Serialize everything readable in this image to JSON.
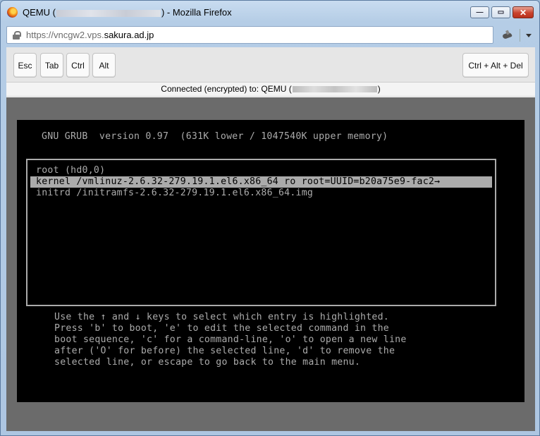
{
  "window": {
    "title_prefix": "QEMU (",
    "title_suffix": ") - Mozilla Firefox",
    "minimize_glyph": "—",
    "maximize_glyph": "▭",
    "close_glyph": "✕",
    "icon": "firefox-icon"
  },
  "urlbar": {
    "scheme": "https://vncgw2.vps.",
    "host": "sakura.ad.jp",
    "lock_icon": "lock-icon",
    "addon_icon": "addon-icon"
  },
  "keys": {
    "esc": "Esc",
    "tab": "Tab",
    "ctrl": "Ctrl",
    "alt": "Alt",
    "ctrl_alt_del": "Ctrl + Alt + Del"
  },
  "status": {
    "prefix": "Connected (encrypted) to: QEMU (",
    "suffix": ")"
  },
  "grub": {
    "header": "GNU GRUB  version 0.97  (631K lower / 1047540K upper memory)",
    "entries": [
      "root (hd0,0)",
      "kernel /vmlinuz-2.6.32-279.19.1.el6.x86_64 ro root=UUID=b20a75e9-fac2→",
      "initrd /initramfs-2.6.32-279.19.1.el6.x86_64.img"
    ],
    "selected_index": 1,
    "help_lines": [
      "Use the ↑ and ↓ keys to select which entry is highlighted.",
      "Press 'b' to boot, 'e' to edit the selected command in the",
      "boot sequence, 'c' for a command-line, 'o' to open a new line",
      "after ('O' for before) the selected line, 'd' to remove the",
      "selected line, or escape to go back to the main menu."
    ]
  },
  "colors": {
    "console_fg": "#ababab",
    "console_bg": "#000000",
    "vnc_bg": "#6b6b6b"
  }
}
